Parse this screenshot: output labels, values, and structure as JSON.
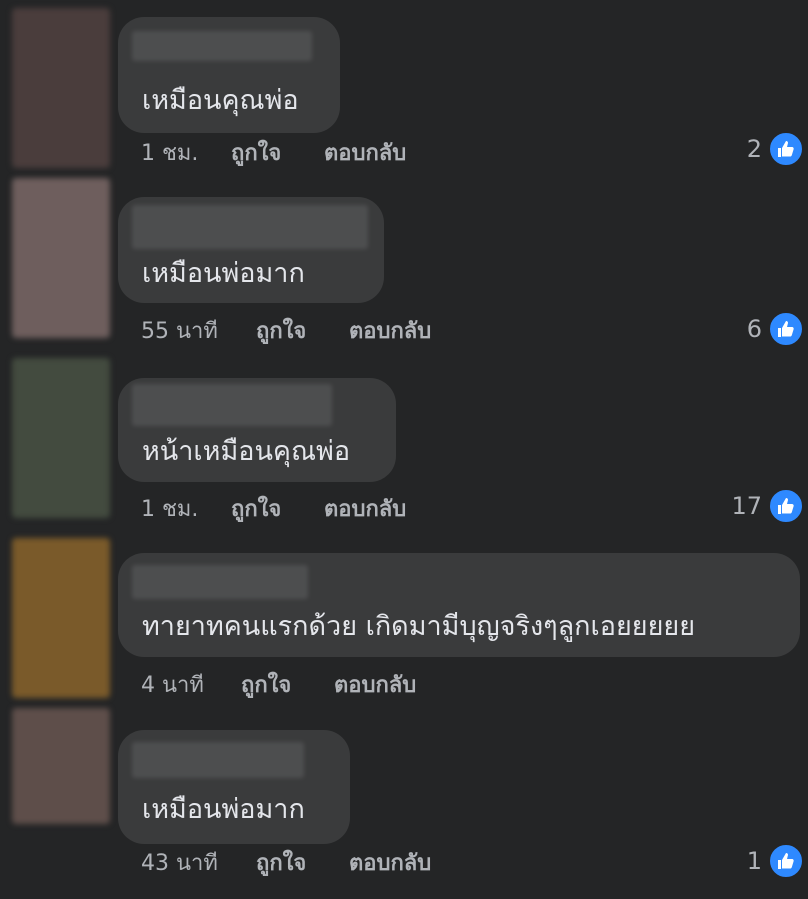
{
  "actions": {
    "like": "ถูกใจ",
    "reply": "ตอบกลับ"
  },
  "colors": {
    "bubble": "#3a3b3c",
    "background": "#242526",
    "like_icon": "#2e89ff"
  },
  "comments": [
    {
      "avatar_color": "#4a3d3c",
      "text": "เหมือนคุณพ่อ",
      "time": "1 ชม.",
      "likes": "2"
    },
    {
      "avatar_color": "#6e5e5d",
      "text": "เหมือนพ่อมาก",
      "time": "55 นาที",
      "likes": "6"
    },
    {
      "avatar_color": "#434b3f",
      "text": "หน้าเหมือนคุณพ่อ",
      "time": "1 ชม.",
      "likes": "17"
    },
    {
      "avatar_color": "#7a5a2a",
      "text": "ทายาทคนแรกด้วย เกิดมามีบุญจริงๆลูกเอยยยยย",
      "time": "4 นาที",
      "likes": ""
    },
    {
      "avatar_color": "#5e4e4a",
      "text": "เหมือนพ่อมาก",
      "time": "43 นาที",
      "likes": "1"
    }
  ]
}
